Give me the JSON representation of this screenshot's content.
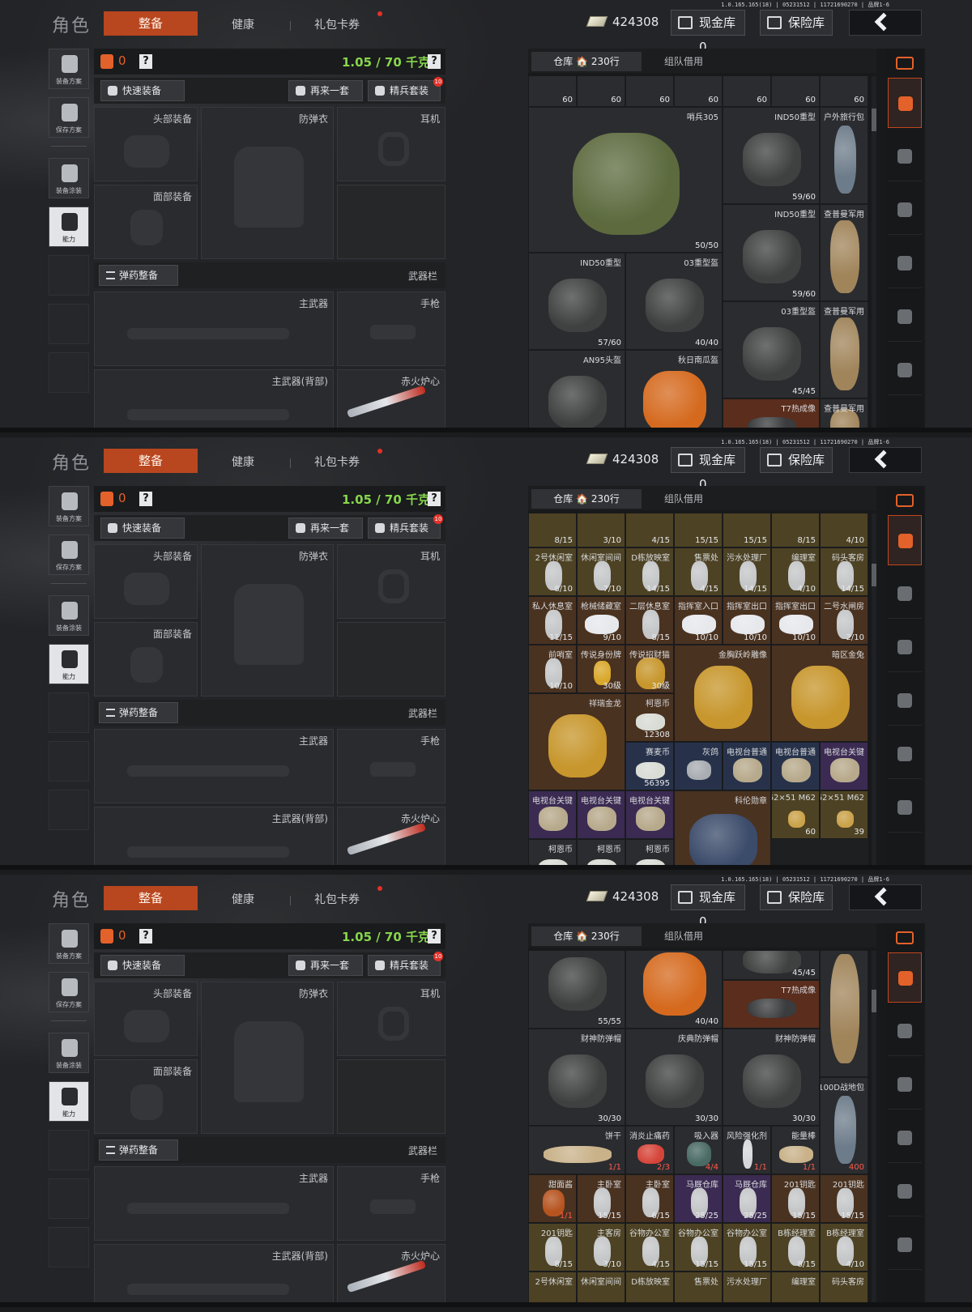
{
  "version": "1.0.165.165(18) | 05231512 | 11721690270 | 品牌1-6",
  "top": {
    "title": "角色",
    "tab_active": "整备",
    "tab_health": "健康",
    "tab_gift": "礼包卡券",
    "money": "424308",
    "cash_vault": "现金库 0",
    "safe_vault": "保险库"
  },
  "side_tools": {
    "loadout": "装备方案",
    "save": "保存方案",
    "skin": "装备涂装",
    "ability": "能力"
  },
  "left": {
    "bag_count": "0",
    "help": "?",
    "weight": "1.05 / 70 千克",
    "quick_equip": "快速装备",
    "repeat": "再来一套",
    "elite": "精兵套装",
    "elite_badge": "10",
    "slot_head": "头部装备",
    "slot_armor": "防弹衣",
    "slot_ear": "耳机",
    "slot_face": "面部装备",
    "ammo": "弹药整备",
    "weapons": "武器栏",
    "slot_main": "主武器",
    "slot_pistol": "手枪",
    "slot_main_back": "主武器(背部)",
    "slot_melee": "赤火炉心"
  },
  "right": {
    "tab_warehouse": "仓库 🏠 230行",
    "tab_team": "组队借用"
  },
  "panel1_cells": [
    {
      "n": "",
      "c": "60"
    },
    {
      "n": "",
      "c": "60"
    },
    {
      "n": "",
      "c": "60"
    },
    {
      "n": "",
      "c": "60"
    },
    {
      "n": "",
      "c": "60"
    },
    {
      "n": "",
      "c": "60"
    },
    {
      "n": "",
      "c": "60"
    },
    {
      "n": "哨兵305",
      "c": "50/50"
    },
    {
      "n": "IND50重型",
      "c": "59/60"
    },
    {
      "n": "户外旅行包",
      "c": ""
    },
    {
      "n": "IND50重型",
      "c": "59/60"
    },
    {
      "n": "查普曼军用",
      "c": ""
    },
    {
      "n": "IND50重型",
      "c": "57/60"
    },
    {
      "n": "03重型盔",
      "c": "40/40"
    },
    {
      "n": "03重型盔",
      "c": "45/45"
    },
    {
      "n": "查普曼军用",
      "c": ""
    },
    {
      "n": "AN95头盔",
      "c": "55/55"
    },
    {
      "n": "秋日南瓜盔",
      "c": "40/40"
    },
    {
      "n": "T7热成像",
      "c": ""
    },
    {
      "n": "查普曼军用",
      "c": ""
    }
  ],
  "panel2_cells": [
    {
      "n": "",
      "c": "8/15"
    },
    {
      "n": "",
      "c": "3/10"
    },
    {
      "n": "",
      "c": "4/15"
    },
    {
      "n": "",
      "c": "15/15"
    },
    {
      "n": "",
      "c": "15/15"
    },
    {
      "n": "",
      "c": "8/15"
    },
    {
      "n": "",
      "c": "4/10"
    },
    {
      "n": "2号休闲室",
      "c": "8/10"
    },
    {
      "n": "休闲室间间",
      "c": "7/10"
    },
    {
      "n": "D栋放映室",
      "c": "14/15"
    },
    {
      "n": "售票处",
      "c": "4/15"
    },
    {
      "n": "污水处理厂",
      "c": "14/15"
    },
    {
      "n": "编理室",
      "c": "4/10"
    },
    {
      "n": "码头客房",
      "c": "14/15"
    },
    {
      "n": "私人休息室",
      "c": "11/15"
    },
    {
      "n": "枪械储藏室",
      "c": "9/10"
    },
    {
      "n": "二层休息室",
      "c": "8/15"
    },
    {
      "n": "指挥室入口",
      "c": "10/10"
    },
    {
      "n": "指挥室出口",
      "c": "10/10"
    },
    {
      "n": "指挥室出口",
      "c": "10/10"
    },
    {
      "n": "二号水闸房",
      "c": "2/10"
    },
    {
      "n": "前哨室",
      "c": "10/10"
    },
    {
      "n": "传说身份牌",
      "c": "30级"
    },
    {
      "n": "传说招财猫",
      "c": "30级"
    },
    {
      "n": "金胸跃岭雕像",
      "c": ""
    },
    {
      "n": "暗区金兔",
      "c": ""
    },
    {
      "n": "祥瑞金龙",
      "c": ""
    },
    {
      "n": "柯恩币",
      "c": "12308"
    },
    {
      "n": "赛麦币",
      "c": "56395"
    },
    {
      "n": "灰鸽",
      "c": ""
    },
    {
      "n": "电视台普通",
      "c": ""
    },
    {
      "n": "电视台普通",
      "c": ""
    },
    {
      "n": "电视台关键",
      "c": ""
    },
    {
      "n": "电视台关键",
      "c": ""
    },
    {
      "n": "电视台关键",
      "c": ""
    },
    {
      "n": "电视台关键",
      "c": ""
    },
    {
      "n": "科伦勋章",
      "c": ""
    },
    {
      "n": "7.62×51 M62",
      "c": "60"
    },
    {
      "n": "7.62×51 M62",
      "c": "39"
    },
    {
      "n": "柯恩币",
      "c": ""
    },
    {
      "n": "柯恩币",
      "c": ""
    },
    {
      "n": "柯恩币",
      "c": ""
    }
  ],
  "panel3_cells": [
    {
      "n": "AN95头盔",
      "c": "55/55"
    },
    {
      "n": "秋日南瓜盔",
      "c": "40/40"
    },
    {
      "n": "",
      "c": "45/45"
    },
    {
      "n": "T7热成像",
      "c": ""
    },
    {
      "n": "查普曼军用",
      "c": ""
    },
    {
      "n": "财神防弹帽",
      "c": "30/30"
    },
    {
      "n": "庆典防弹帽",
      "c": "30/30"
    },
    {
      "n": "财神防弹帽",
      "c": "30/30"
    },
    {
      "n": "100D战地包",
      "c": "400"
    },
    {
      "n": "饼干",
      "c": "1/1"
    },
    {
      "n": "消炎止痛药",
      "c": "2/3"
    },
    {
      "n": "吸入器",
      "c": "4/4"
    },
    {
      "n": "风险强化剂",
      "c": "1/1"
    },
    {
      "n": "能量棒",
      "c": "1/1"
    },
    {
      "n": "甜面酱",
      "c": "1/1"
    },
    {
      "n": "主卧室",
      "c": "15/15"
    },
    {
      "n": "主卧室",
      "c": "6/15"
    },
    {
      "n": "马厩仓库",
      "c": "25/25"
    },
    {
      "n": "马厩仓库",
      "c": "25/25"
    },
    {
      "n": "201钥匙",
      "c": "15/15"
    },
    {
      "n": "201钥匙",
      "c": "15/15"
    },
    {
      "n": "201钥匙",
      "c": "8/15"
    },
    {
      "n": "主客房",
      "c": "3/10"
    },
    {
      "n": "谷物办公室",
      "c": "4/15"
    },
    {
      "n": "谷物办公室",
      "c": "15/15"
    },
    {
      "n": "谷物办公室",
      "c": "15/15"
    },
    {
      "n": "B栋经理室",
      "c": "8/15"
    },
    {
      "n": "B栋经理室",
      "c": "4/10"
    },
    {
      "n": "2号休闲室",
      "c": ""
    },
    {
      "n": "休闲室间间",
      "c": ""
    },
    {
      "n": "D栋放映室",
      "c": ""
    },
    {
      "n": "售票处",
      "c": ""
    },
    {
      "n": "污水处理厂",
      "c": ""
    },
    {
      "n": "编理室",
      "c": ""
    },
    {
      "n": "码头客房",
      "c": ""
    }
  ]
}
